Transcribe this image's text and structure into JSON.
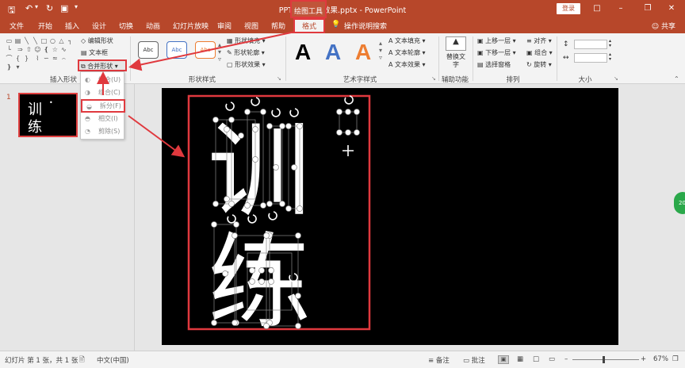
{
  "window": {
    "title": "PPT文字拆分效果.pptx - PowerPoint",
    "context_tab": "绘图工具",
    "login": "登录",
    "share": "共享"
  },
  "tabs": [
    "文件",
    "开始",
    "插入",
    "设计",
    "切换",
    "动画",
    "幻灯片放映",
    "审阅",
    "视图",
    "帮助"
  ],
  "active_tab": "格式",
  "tell_me": "操作说明搜索",
  "ribbon": {
    "insert_shapes": {
      "label": "插入形状",
      "edit_shape": "编辑形状",
      "text_box": "文本框",
      "merge_shapes": "合并形状"
    },
    "shape_styles": {
      "label": "形状样式",
      "preview": "Abc",
      "fill": "形状填充",
      "outline": "形状轮廓",
      "effects": "形状效果"
    },
    "wordart": {
      "label": "艺术字样式",
      "glyph": "A",
      "text_fill": "文本填充",
      "text_outline": "文本轮廓",
      "text_effects": "文本效果"
    },
    "accessibility": {
      "label": "辅助功能",
      "alt_text": "替换文字"
    },
    "arrange": {
      "label": "排列",
      "bring_forward": "上移一层",
      "send_backward": "下移一层",
      "selection_pane": "选择窗格",
      "align": "对齐",
      "group": "组合",
      "rotate": "旋转"
    },
    "size": {
      "label": "大小"
    }
  },
  "merge_menu": {
    "items": [
      "结合(U)",
      "组合(C)",
      "拆分(F)",
      "相交(I)",
      "剪除(S)"
    ]
  },
  "thumbnail": {
    "number": "1",
    "line1": "训",
    "line2": "练"
  },
  "slide": {
    "char1": "训",
    "char2": "练"
  },
  "status": {
    "slide_info": "幻灯片 第 1 张，共 1 张",
    "language": "中文(中国)",
    "notes": "备注",
    "comments": "批注",
    "zoom": "67%"
  },
  "colors": {
    "accent": "#b7472a",
    "highlight": "#e0393e"
  }
}
